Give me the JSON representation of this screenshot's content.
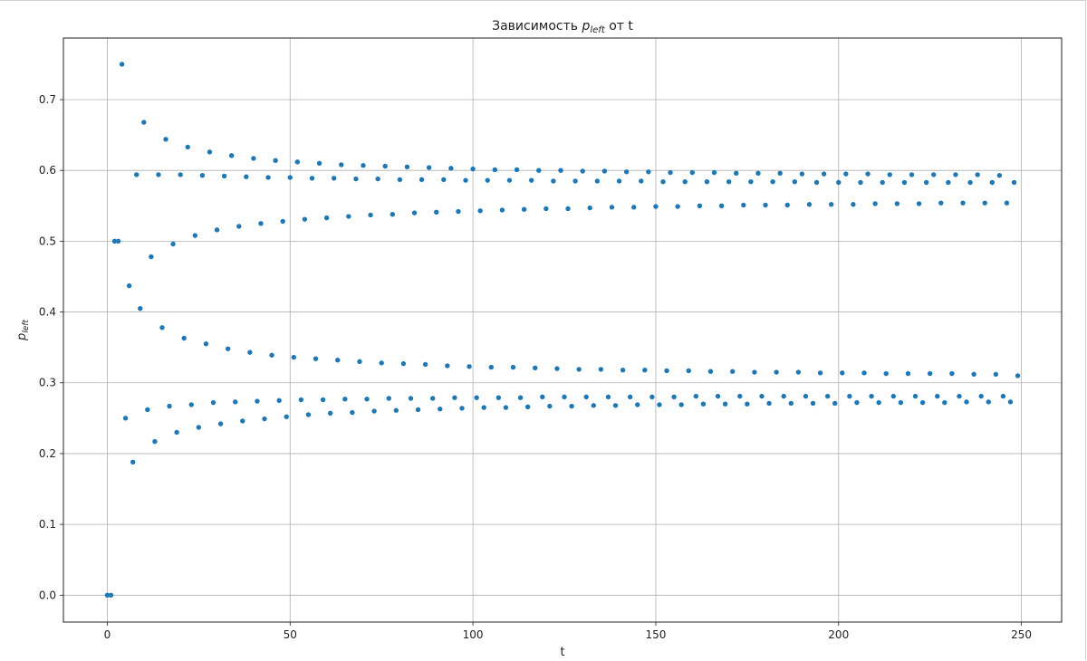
{
  "chart_data": {
    "type": "scatter",
    "title": {
      "prefix": "Зависимость ",
      "var_main": "p",
      "var_sub": "left",
      "suffix": " от t"
    },
    "xlabel": "t",
    "ylabel": {
      "main": "p",
      "sub": "left"
    },
    "xlim": [
      -12,
      261
    ],
    "ylim": [
      -0.038,
      0.787
    ],
    "xticks": [
      0,
      50,
      100,
      150,
      200,
      250
    ],
    "yticks": [
      0.0,
      0.1,
      0.2,
      0.3,
      0.4,
      0.5,
      0.6,
      0.7
    ],
    "grid": true,
    "marker_color": "#1f77b4",
    "x": [
      0,
      1,
      2,
      3,
      4,
      5,
      6,
      7,
      8,
      9,
      10,
      11,
      12,
      13,
      14,
      15,
      16,
      17,
      18,
      19,
      20,
      21,
      22,
      23,
      24,
      25,
      26,
      27,
      28,
      29,
      30,
      31,
      32,
      33,
      34,
      35,
      36,
      37,
      38,
      39,
      40,
      41,
      42,
      43,
      44,
      45,
      46,
      47,
      48,
      49,
      50,
      51,
      52,
      53,
      54,
      55,
      56,
      57,
      58,
      59,
      60,
      61,
      62,
      63,
      64,
      65,
      66,
      67,
      68,
      69,
      70,
      71,
      72,
      73,
      74,
      75,
      76,
      77,
      78,
      79,
      80,
      81,
      82,
      83,
      84,
      85,
      86,
      87,
      88,
      89,
      90,
      91,
      92,
      93,
      94,
      95,
      96,
      97,
      98,
      99,
      100,
      101,
      102,
      103,
      104,
      105,
      106,
      107,
      108,
      109,
      110,
      111,
      112,
      113,
      114,
      115,
      116,
      117,
      118,
      119,
      120,
      121,
      122,
      123,
      124,
      125,
      126,
      127,
      128,
      129,
      130,
      131,
      132,
      133,
      134,
      135,
      136,
      137,
      138,
      139,
      140,
      141,
      142,
      143,
      144,
      145,
      146,
      147,
      148,
      149,
      150,
      151,
      152,
      153,
      154,
      155,
      156,
      157,
      158,
      159,
      160,
      161,
      162,
      163,
      164,
      165,
      166,
      167,
      168,
      169,
      170,
      171,
      172,
      173,
      174,
      175,
      176,
      177,
      178,
      179,
      180,
      181,
      182,
      183,
      184,
      185,
      186,
      187,
      188,
      189,
      190,
      191,
      192,
      193,
      194,
      195,
      196,
      197,
      198,
      199,
      200,
      201,
      202,
      203,
      204,
      205,
      206,
      207,
      208,
      209,
      210,
      211,
      212,
      213,
      214,
      215,
      216,
      217,
      218,
      219,
      220,
      221,
      222,
      223,
      224,
      225,
      226,
      227,
      228,
      229,
      230,
      231,
      232,
      233,
      234,
      235,
      236,
      237,
      238,
      239,
      240,
      241,
      242,
      243,
      244,
      245,
      246,
      247,
      248,
      249
    ],
    "y": [
      0.0,
      0.0,
      0.5,
      0.5,
      0.75,
      0.25,
      0.437,
      0.188,
      0.594,
      0.405,
      0.668,
      0.262,
      0.478,
      0.217,
      0.594,
      0.378,
      0.644,
      0.267,
      0.496,
      0.23,
      0.594,
      0.363,
      0.633,
      0.269,
      0.508,
      0.237,
      0.593,
      0.355,
      0.626,
      0.272,
      0.516,
      0.242,
      0.592,
      0.348,
      0.621,
      0.273,
      0.521,
      0.246,
      0.591,
      0.343,
      0.617,
      0.274,
      0.525,
      0.249,
      0.59,
      0.339,
      0.614,
      0.275,
      0.528,
      0.252,
      0.59,
      0.336,
      0.612,
      0.276,
      0.531,
      0.255,
      0.589,
      0.334,
      0.61,
      0.276,
      0.533,
      0.257,
      0.589,
      0.332,
      0.608,
      0.277,
      0.535,
      0.258,
      0.588,
      0.33,
      0.607,
      0.277,
      0.537,
      0.26,
      0.588,
      0.328,
      0.606,
      0.278,
      0.538,
      0.261,
      0.587,
      0.327,
      0.605,
      0.278,
      0.54,
      0.262,
      0.587,
      0.326,
      0.604,
      0.278,
      0.541,
      0.263,
      0.587,
      0.324,
      0.603,
      0.279,
      0.542,
      0.264,
      0.586,
      0.323,
      0.602,
      0.279,
      0.543,
      0.265,
      0.586,
      0.322,
      0.601,
      0.279,
      0.544,
      0.265,
      0.586,
      0.322,
      0.601,
      0.279,
      0.545,
      0.266,
      0.586,
      0.321,
      0.6,
      0.28,
      0.546,
      0.267,
      0.585,
      0.32,
      0.6,
      0.28,
      0.546,
      0.267,
      0.585,
      0.319,
      0.599,
      0.28,
      0.547,
      0.268,
      0.585,
      0.319,
      0.599,
      0.28,
      0.548,
      0.268,
      0.585,
      0.318,
      0.598,
      0.28,
      0.548,
      0.269,
      0.585,
      0.318,
      0.598,
      0.28,
      0.549,
      0.269,
      0.584,
      0.317,
      0.597,
      0.28,
      0.549,
      0.269,
      0.584,
      0.317,
      0.597,
      0.281,
      0.55,
      0.27,
      0.584,
      0.316,
      0.597,
      0.281,
      0.55,
      0.27,
      0.584,
      0.316,
      0.596,
      0.281,
      0.551,
      0.27,
      0.584,
      0.315,
      0.596,
      0.281,
      0.551,
      0.271,
      0.584,
      0.315,
      0.596,
      0.281,
      0.551,
      0.271,
      0.584,
      0.315,
      0.595,
      0.281,
      0.552,
      0.271,
      0.583,
      0.314,
      0.595,
      0.281,
      0.552,
      0.271,
      0.583,
      0.314,
      0.595,
      0.281,
      0.552,
      0.272,
      0.583,
      0.314,
      0.595,
      0.281,
      0.553,
      0.272,
      0.583,
      0.313,
      0.594,
      0.281,
      0.553,
      0.272,
      0.583,
      0.313,
      0.594,
      0.281,
      0.553,
      0.272,
      0.583,
      0.313,
      0.594,
      0.281,
      0.554,
      0.272,
      0.583,
      0.313,
      0.594,
      0.281,
      0.554,
      0.273,
      0.583,
      0.312,
      0.594,
      0.281,
      0.554,
      0.273,
      0.583,
      0.312,
      0.593,
      0.281,
      0.554,
      0.273,
      0.583,
      0.31
    ]
  }
}
